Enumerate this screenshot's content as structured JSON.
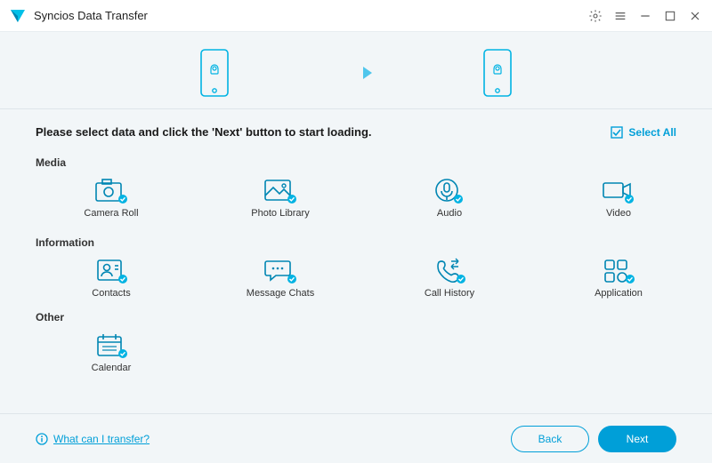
{
  "titlebar": {
    "app_name": "Syncios Data Transfer",
    "icons": {
      "logo": "syncios-logo",
      "settings": "gear-icon",
      "menu": "menu-icon",
      "minimize": "minimize-icon",
      "maximize": "maximize-icon",
      "close": "close-icon"
    }
  },
  "instruction": "Please select data and click the 'Next' button to start loading.",
  "select_all_label": "Select All",
  "sections": {
    "media": {
      "title": "Media",
      "items": [
        {
          "label": "Camera Roll",
          "icon": "camera-roll-icon"
        },
        {
          "label": "Photo Library",
          "icon": "photo-library-icon"
        },
        {
          "label": "Audio",
          "icon": "audio-icon"
        },
        {
          "label": "Video",
          "icon": "video-icon"
        }
      ]
    },
    "information": {
      "title": "Information",
      "items": [
        {
          "label": "Contacts",
          "icon": "contacts-icon"
        },
        {
          "label": "Message Chats",
          "icon": "message-chats-icon"
        },
        {
          "label": "Call History",
          "icon": "call-history-icon"
        },
        {
          "label": "Application",
          "icon": "application-icon"
        }
      ]
    },
    "other": {
      "title": "Other",
      "items": [
        {
          "label": "Calendar",
          "icon": "calendar-icon"
        }
      ]
    }
  },
  "footer": {
    "help_label": "What can I transfer?",
    "back_label": "Back",
    "next_label": "Next"
  },
  "colors": {
    "accent": "#009fd8"
  }
}
